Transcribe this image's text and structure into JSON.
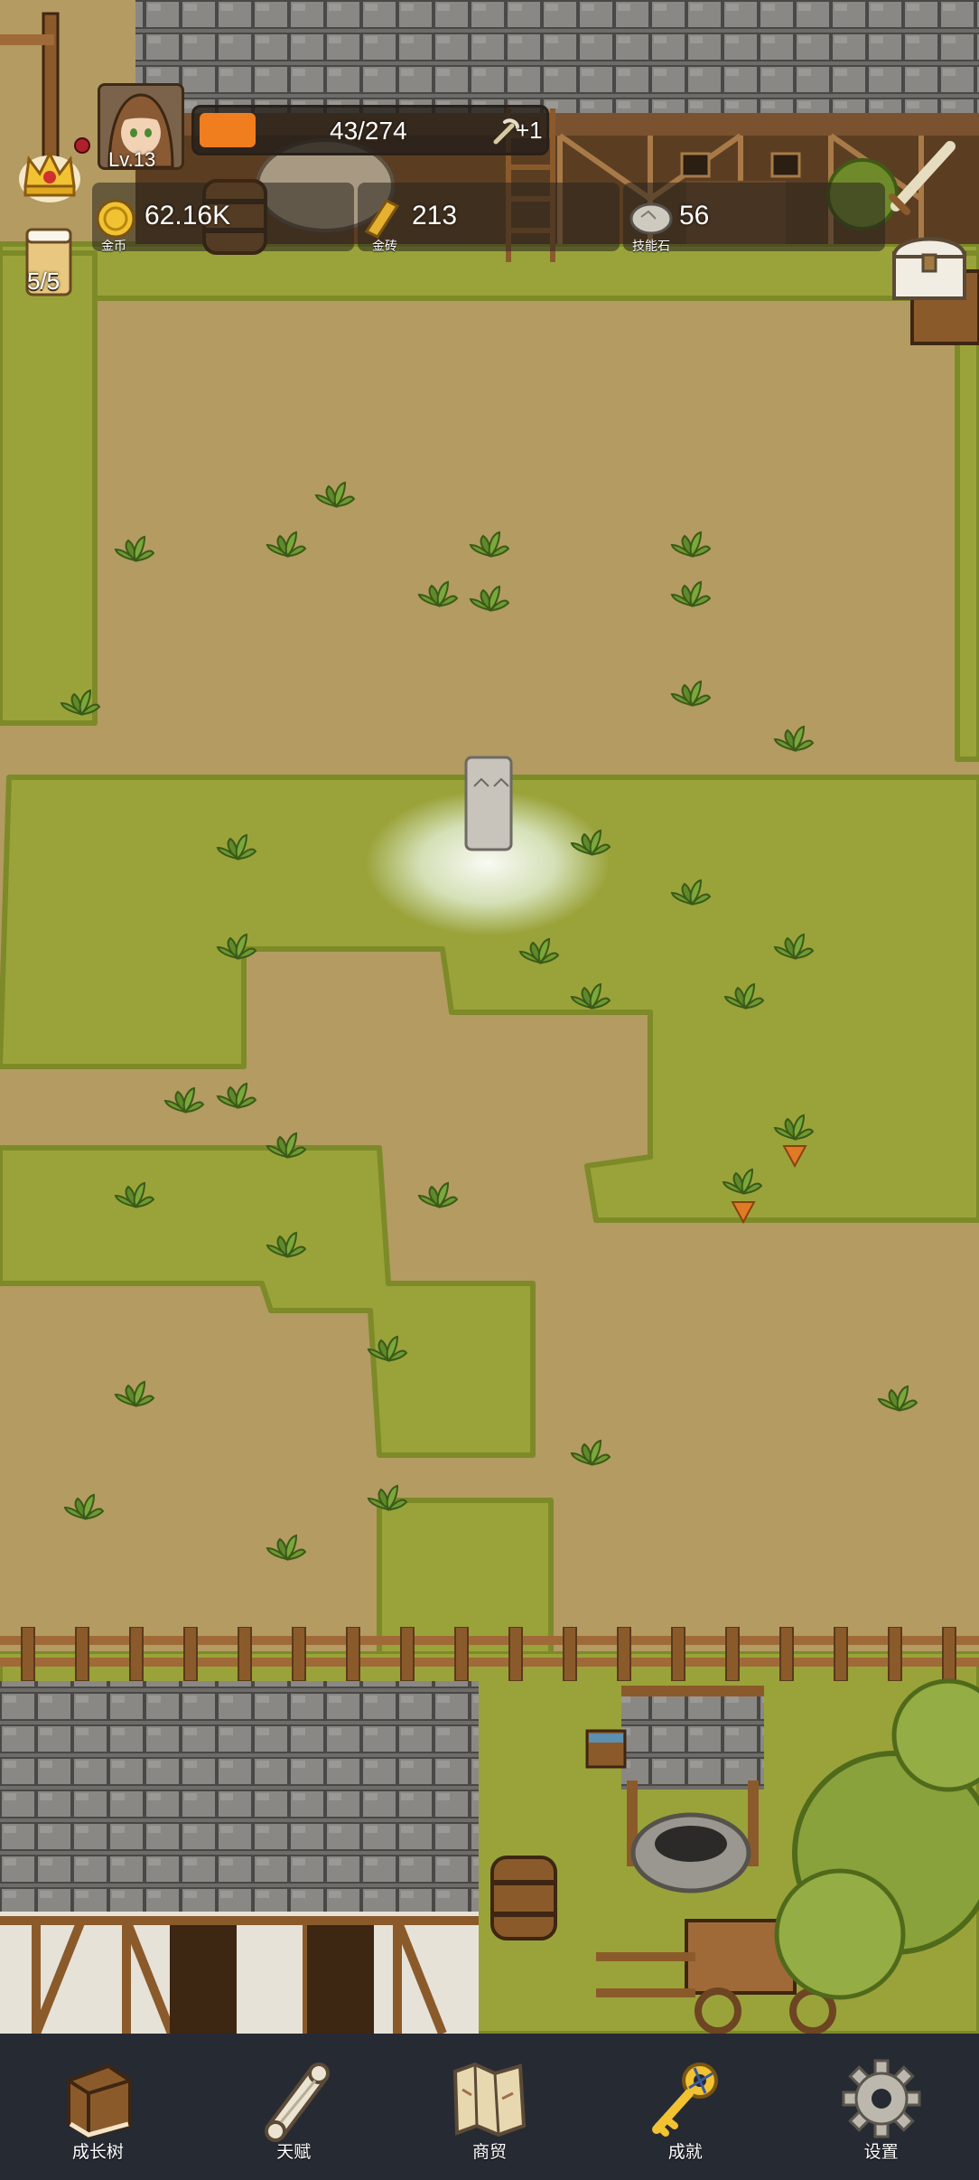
{
  "hud": {
    "level": "Lv.13",
    "exp_text": "43/274",
    "exp_ratio": 0.163,
    "exp_bonus": "+1",
    "beer_count": "5/5",
    "currencies": [
      {
        "id": "gold",
        "value": "62.16K",
        "label": "金币",
        "icon": "gold-coin-icon"
      },
      {
        "id": "brick",
        "value": "213",
        "label": "金砖",
        "icon": "gold-bar-icon"
      },
      {
        "id": "stone",
        "value": "56",
        "label": "技能石",
        "icon": "skill-stone-icon"
      }
    ]
  },
  "nav": {
    "items": [
      {
        "label": "成长树",
        "icon": "book-icon"
      },
      {
        "label": "天赋",
        "icon": "scroll-icon"
      },
      {
        "label": "商贸",
        "icon": "map-icon"
      },
      {
        "label": "成就",
        "icon": "key-icon"
      },
      {
        "label": "设置",
        "icon": "gear-icon"
      }
    ]
  },
  "colors": {
    "dirt": "#b39b62",
    "grass": "#9aa33a",
    "exp_fill": "#f07d1e",
    "nav_bg": "#262a33"
  }
}
